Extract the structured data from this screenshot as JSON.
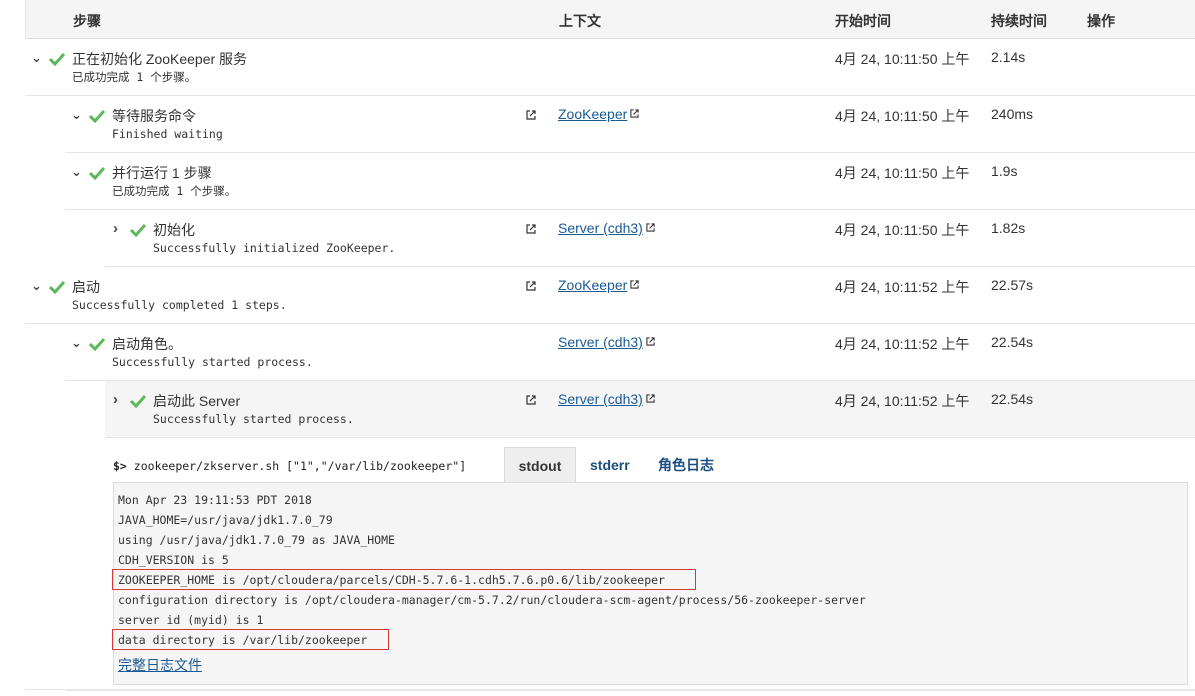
{
  "header": {
    "col_step": "步骤",
    "col_context": "上下文",
    "col_start": "开始时间",
    "col_duration": "持续时间",
    "col_actions": "操作"
  },
  "steps": [
    {
      "title": "正在初始化 ZooKeeper 服务",
      "sub": "已成功完成 1 个步骤。",
      "context": "",
      "start": "4月 24, 10:11:50 上午",
      "duration": "2.14s",
      "chevron": "down",
      "link_icon": false
    },
    {
      "title": "等待服务命令",
      "sub": "Finished waiting",
      "context": "ZooKeeper",
      "start": "4月 24, 10:11:50 上午",
      "duration": "240ms",
      "chevron": "down",
      "link_icon": true
    },
    {
      "title": "并行运行 1 步骤",
      "sub": "已成功完成 1 个步骤。",
      "context": "",
      "start": "4月 24, 10:11:50 上午",
      "duration": "1.9s",
      "chevron": "down",
      "link_icon": false
    },
    {
      "title": "初始化",
      "sub": "Successfully initialized ZooKeeper.",
      "context": "Server (cdh3)",
      "start": "4月 24, 10:11:50 上午",
      "duration": "1.82s",
      "chevron": "right",
      "link_icon": true
    },
    {
      "title": "启动",
      "sub": "Successfully completed 1 steps.",
      "context": "ZooKeeper",
      "start": "4月 24, 10:11:52 上午",
      "duration": "22.57s",
      "chevron": "down",
      "link_icon": true
    },
    {
      "title": "启动角色。",
      "sub": "Successfully started process.",
      "context": "Server (cdh3)",
      "start": "4月 24, 10:11:52 上午",
      "duration": "22.54s",
      "chevron": "down",
      "link_icon": false
    },
    {
      "title": "启动此 Server",
      "sub": "Successfully started process.",
      "context": "Server (cdh3)",
      "start": "4月 24, 10:11:52 上午",
      "duration": "22.54s",
      "chevron": "right",
      "link_icon": true
    }
  ],
  "detail": {
    "prompt": "$>",
    "command": "zookeeper/zkserver.sh [\"1\",\"/var/lib/zookeeper\"]",
    "tabs": [
      "stdout",
      "stderr",
      "角色日志"
    ],
    "active_tab": "stdout",
    "log_lines": [
      "Mon Apr 23 19:11:53 PDT 2018",
      "JAVA_HOME=/usr/java/jdk1.7.0_79",
      "using /usr/java/jdk1.7.0_79 as JAVA_HOME",
      "CDH_VERSION is 5",
      "ZOOKEEPER_HOME is /opt/cloudera/parcels/CDH-5.7.6-1.cdh5.7.6.p0.6/lib/zookeeper",
      "configuration directory is /opt/cloudera-manager/cm-5.7.2/run/cloudera-scm-agent/process/56-zookeeper-server",
      "server id (myid) is 1",
      "data directory is /var/lib/zookeeper"
    ],
    "full_log_link": "完整日志文件"
  },
  "colors": {
    "success_green": "#5cb85c",
    "link_blue": "#1a5a96",
    "highlight_red": "#d03a3a"
  }
}
